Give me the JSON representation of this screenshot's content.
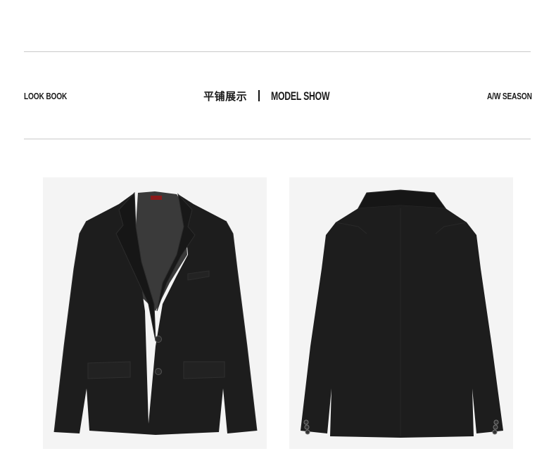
{
  "header": {
    "left_label": "LOOK BOOK",
    "center_cn": "平铺展示",
    "center_en": "MODEL SHOW",
    "right_label": "A/W SEASON"
  },
  "images": {
    "front": {
      "icon": "blazer-front-image"
    },
    "back": {
      "icon": "blazer-back-image"
    }
  },
  "colors": {
    "background": "#ffffff",
    "photo_bg": "#f4f4f4",
    "garment": "#1c1c1c",
    "rule": "#c9c9c9",
    "label_red": "#8b1a1a"
  }
}
